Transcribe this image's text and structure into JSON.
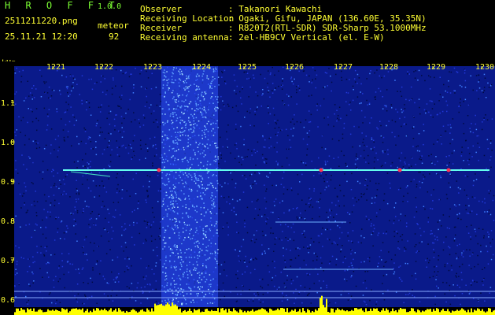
{
  "header": {
    "title": "H R O F F T",
    "version": "1.0.0",
    "filename": "2511211220.png",
    "datetime": "25.11.21 12:20",
    "mode": "meteor",
    "count": "92"
  },
  "info": [
    {
      "key": "Observer",
      "value": ": Takanori Kawachi"
    },
    {
      "key": "Receiving Location",
      "value": ": Ogaki, Gifu, JAPAN (136.60E, 35.35N)"
    },
    {
      "key": "Receiver",
      "value": ": R820T2(RTL-SDR) SDR-Sharp 53.1000MHz"
    },
    {
      "key": "Receiving antenna",
      "value": ": 2el-HB9CV Vertical (el. E-W)"
    }
  ],
  "axis": {
    "unit": "kHz",
    "time_ticks": [
      "1221",
      "1222",
      "1223",
      "1224",
      "1225",
      "1226",
      "1227",
      "1228",
      "1229",
      "1230"
    ],
    "freq_ticks": [
      "1.1",
      "1.0",
      "0.9",
      "0.8",
      "0.7",
      "0.6"
    ]
  },
  "colors": {
    "background": "#000000",
    "noise": "#1f2fd0",
    "signal": "#66ffee",
    "carrier": "#ff3355",
    "bars": "#ffff00"
  }
}
